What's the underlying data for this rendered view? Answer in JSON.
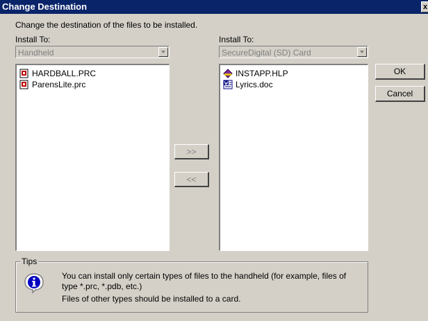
{
  "window": {
    "title": "Change Destination",
    "close_glyph": "x"
  },
  "description": "Change the destination of the files to be installed.",
  "left_panel": {
    "label": "Install To:",
    "combo_value": "Handheld",
    "files": [
      {
        "name": "HARDBALL.PRC",
        "icon": "prc-file-icon"
      },
      {
        "name": "ParensLite.prc",
        "icon": "prc-file-icon"
      }
    ]
  },
  "right_panel": {
    "label": "Install To:",
    "combo_value": "SecureDigital (SD) Card",
    "files": [
      {
        "name": "INSTAPP.HLP",
        "icon": "help-file-icon"
      },
      {
        "name": "Lyrics.doc",
        "icon": "word-doc-icon"
      }
    ]
  },
  "move_buttons": {
    "to_right": ">>",
    "to_left": "<<"
  },
  "buttons": {
    "ok": "OK",
    "cancel": "Cancel"
  },
  "tips": {
    "legend": "Tips",
    "line1": "You can install only certain types of files to the handheld (for example, files of",
    "line2": "type *.prc, *.pdb, etc.)",
    "line3": "Files of other types should be installed to a card.",
    "icon": "info-icon"
  },
  "colors": {
    "titlebar": "#0a246a",
    "dialog_bg": "#d4d0c8",
    "list_bg": "#ffffff"
  }
}
